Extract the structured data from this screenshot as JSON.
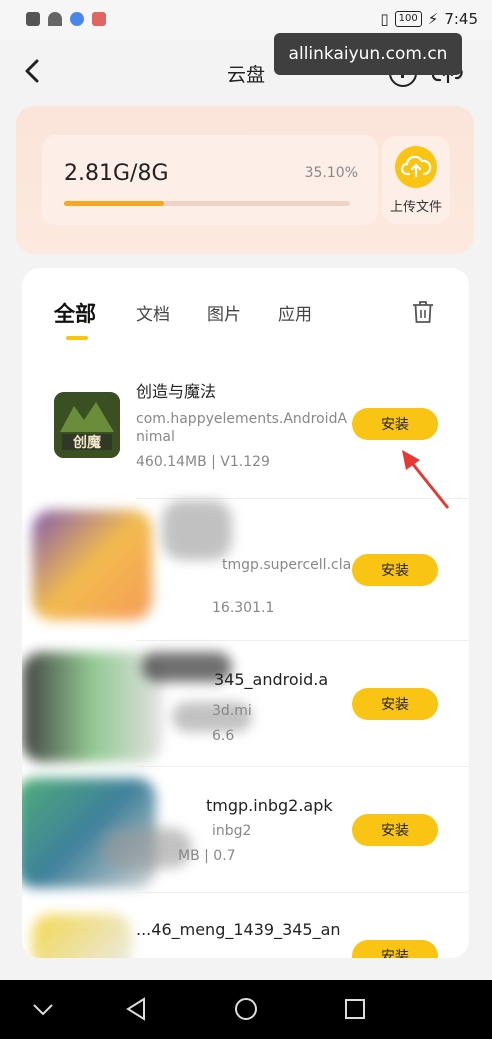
{
  "status_bar": {
    "battery": "100",
    "time": "7:45"
  },
  "watermark": "allinkaiyun.com.cn",
  "header": {
    "title": "云盘"
  },
  "storage": {
    "usage": "2.81G/8G",
    "percent": "35.10%",
    "fraction": 0.351,
    "upload_label": "上传文件"
  },
  "tabs": [
    {
      "label": "全部",
      "active": true
    },
    {
      "label": "文档",
      "active": false
    },
    {
      "label": "图片",
      "active": false
    },
    {
      "label": "应用",
      "active": false
    }
  ],
  "items": [
    {
      "name": "创造与魔法",
      "package": "com.happyelements.AndroidAnimal",
      "meta": "460.14MB | V1.129",
      "button": "安装"
    },
    {
      "name": "",
      "package": "tmgp.supercell.cla",
      "meta": "16.301.1",
      "button": "安装"
    },
    {
      "name": "345_android.a",
      "package": "3d.mi",
      "meta": "6.6",
      "button": "安装"
    },
    {
      "name": "tmgp.inbg2.apk",
      "package": "inbg2",
      "meta": "MB | 0.7",
      "button": "安装"
    },
    {
      "name": "...46_meng_1439_345_an",
      "package": "",
      "meta": "",
      "button": "安装"
    }
  ],
  "colors": {
    "accent": "#f9c413",
    "progress": "#f5a623",
    "card_bg": "#fbe4d9"
  }
}
